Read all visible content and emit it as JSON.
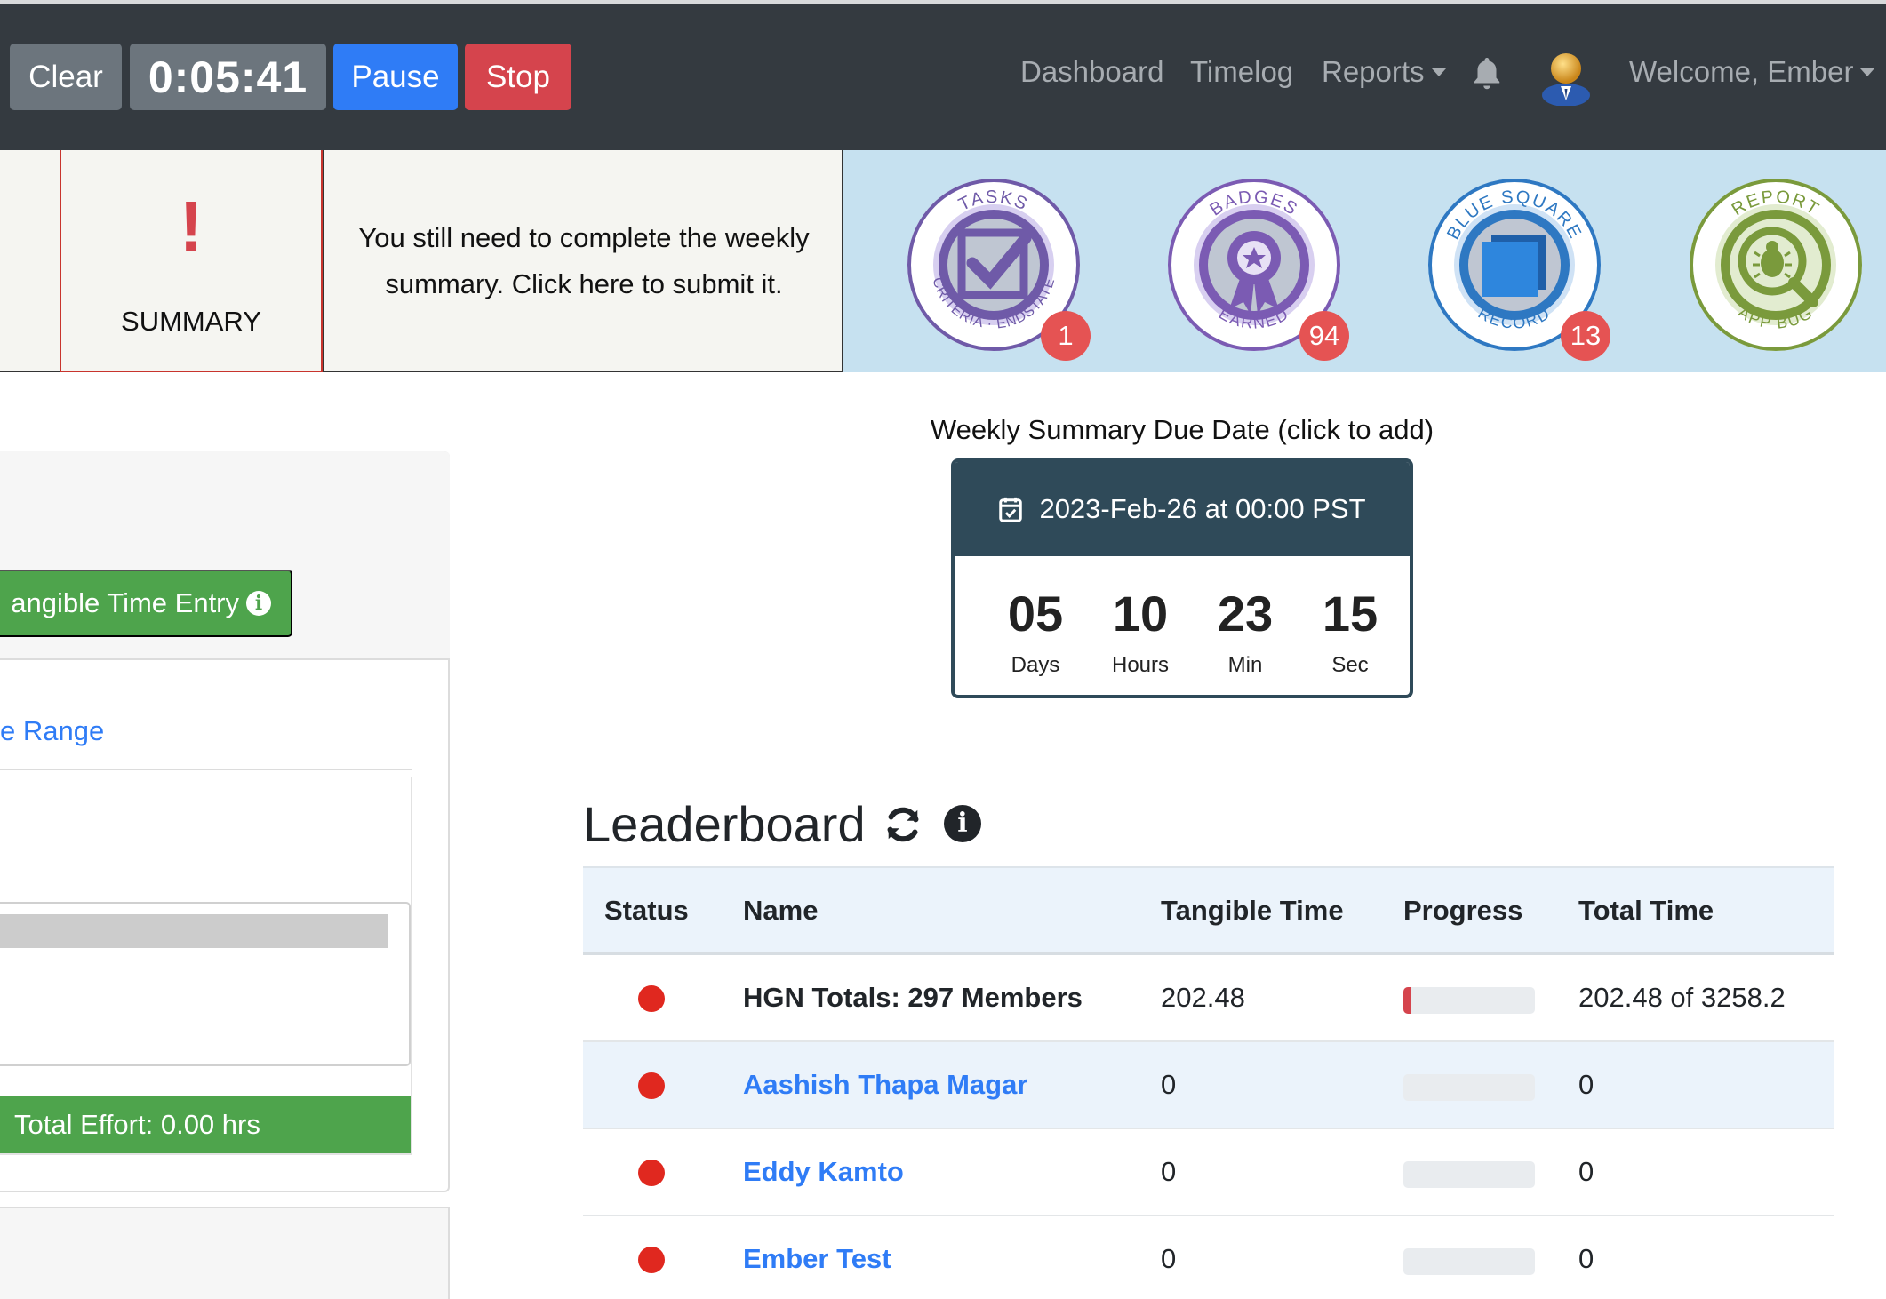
{
  "navbar": {
    "clear_label": "Clear",
    "timer": "0:05:41",
    "pause_label": "Pause",
    "stop_label": "Stop",
    "links": {
      "dashboard": "Dashboard",
      "timelog": "Timelog",
      "reports": "Reports",
      "welcome": "Welcome, Ember"
    },
    "icons": [
      "bell-icon",
      "avatar-icon"
    ]
  },
  "summary_notice": {
    "icon": "!",
    "label": "SUMMARY",
    "message": "You still need to complete the weekly summary. Click here to submit it."
  },
  "badges": [
    {
      "name": "Tasks / Why Criteria Endstate",
      "count": "1",
      "color": "#6f5aa8"
    },
    {
      "name": "Badges Earned",
      "count": "94",
      "color": "#7b5bb3"
    },
    {
      "name": "Blue Square Record",
      "count": "13",
      "color": "#2e78c2"
    },
    {
      "name": "Report App Bug",
      "count": "",
      "color": "#7a9a3c"
    }
  ],
  "left_panel": {
    "add_button": "angible Time Entry",
    "range_link": "e Range",
    "total_effort": "Total Effort: 0.00 hrs"
  },
  "due_date": {
    "label": "Weekly Summary Due Date (click to add)",
    "date": "2023-Feb-26 at 00:00 PST",
    "countdown": [
      {
        "value": "05",
        "unit": "Days"
      },
      {
        "value": "10",
        "unit": "Hours"
      },
      {
        "value": "23",
        "unit": "Min"
      },
      {
        "value": "15",
        "unit": "Sec"
      }
    ]
  },
  "leaderboard": {
    "title": "Leaderboard",
    "columns": {
      "status": "Status",
      "name": "Name",
      "tangible": "Tangible Time",
      "progress": "Progress",
      "total": "Total Time"
    },
    "rows": [
      {
        "name": "HGN Totals: 297 Members",
        "tangible": "202.48",
        "progress_fraction": 0.062,
        "total": "202.48 of 3258.2",
        "status_color": "#e0281f",
        "link": false
      },
      {
        "name": "Aashish Thapa Magar",
        "tangible": "0",
        "progress_fraction": 0,
        "total": "0",
        "status_color": "#e0281f",
        "link": true
      },
      {
        "name": "Eddy Kamto",
        "tangible": "0",
        "progress_fraction": 0,
        "total": "0",
        "status_color": "#e0281f",
        "link": true
      },
      {
        "name": "Ember Test",
        "tangible": "0",
        "progress_fraction": 0,
        "total": "0",
        "status_color": "#e0281f",
        "link": true
      }
    ]
  }
}
